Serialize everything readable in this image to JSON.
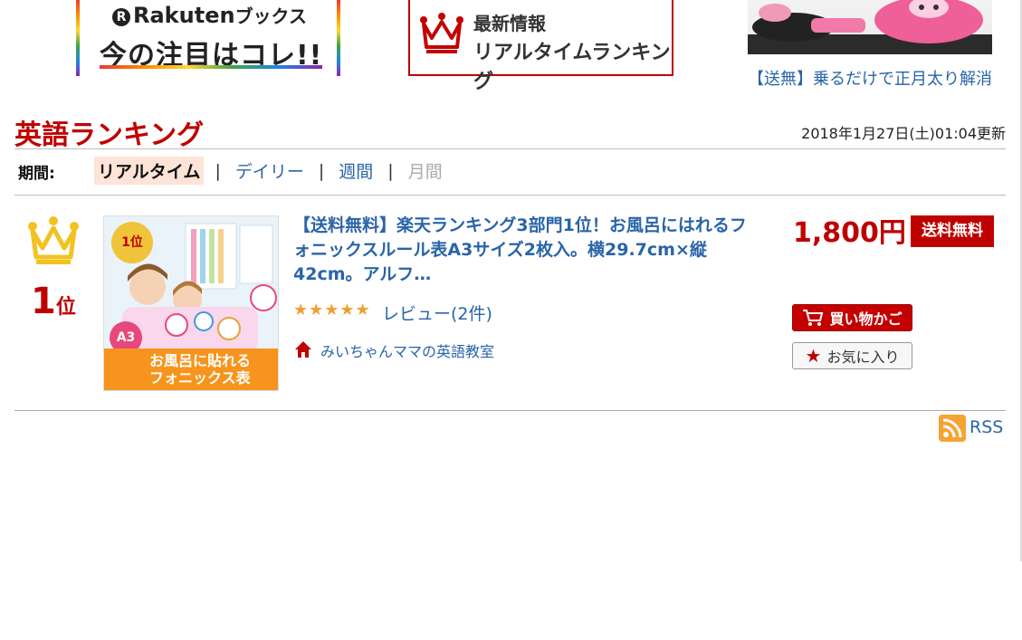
{
  "banners": {
    "books": {
      "brand": "Rakuten",
      "brand_suffix": "ブックス",
      "tagline": "今の注目はコレ!!"
    },
    "ranking": {
      "line1": "最新情報",
      "line2": "リアルタイムランキング"
    },
    "ad": {
      "link_text": "【送無】乗るだけで正月太り解消"
    }
  },
  "header": {
    "title": "英語ランキング",
    "updated": "2018年1月27日(土)01:04更新"
  },
  "period": {
    "label": "期間:",
    "tabs": [
      {
        "label": "リアルタイム",
        "state": "active"
      },
      {
        "label": "デイリー",
        "state": "link"
      },
      {
        "label": "週間",
        "state": "link"
      },
      {
        "label": "月間",
        "state": "disabled"
      }
    ],
    "separator": "|"
  },
  "item": {
    "rank_number": "1",
    "rank_unit": "位",
    "thumbnail": {
      "badge": "1位",
      "size_badge": "A3",
      "caption_line1": "お風呂に貼れる",
      "caption_line2": "フォニックス表"
    },
    "title": "【送料無料】楽天ランキング3部門1位！お風呂にはれるフォニックスルール表A3サイズ2枚入。横29.7cm×縦42cm。アルフ…",
    "rating_stars": "★★★★★",
    "rating": 4.5,
    "reviews": "レビュー(2件)",
    "shop": "みいちゃんママの英語教室",
    "price": "1,800円",
    "free_shipping": "送料無料",
    "cart_button": "買い物かご",
    "favorite_button": "お気に入り"
  },
  "footer": {
    "rss": "RSS"
  },
  "colors": {
    "accent": "#bf0000",
    "link": "#2a64a8",
    "star": "#f0a030",
    "rss": "#f7a334"
  }
}
